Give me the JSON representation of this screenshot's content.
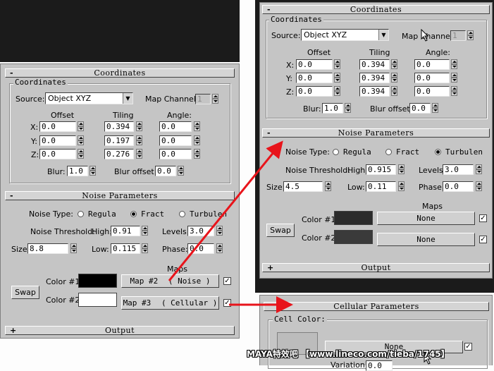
{
  "labels": {
    "coordinates": "Coordinates",
    "coordinates_group": "Coordinates",
    "source": "Source:",
    "map_channel": "Map Channel:",
    "offset": "Offset",
    "tiling": "Tiling",
    "angle": "Angle:",
    "x": "X:",
    "y": "Y:",
    "z": "Z:",
    "blur": "Blur:",
    "blur_offset": "Blur offset:",
    "noise_parameters": "Noise Parameters",
    "noise_type": "Noise Type:",
    "regular": "Regula",
    "fractal": "Fract",
    "turbulence": "Turbulen",
    "noise_threshold": "Noise Threshold:",
    "high": "High:",
    "levels": "Levels:",
    "size": "Size:",
    "low": "Low:",
    "phase": "Phase:",
    "maps": "Maps",
    "color1": "Color #1",
    "color2": "Color #2",
    "swap": "Swap",
    "output": "Output",
    "cellular_parameters": "Cellular Parameters",
    "cell_color": "Cell Color:",
    "variation": "Variation:",
    "none": "None",
    "minus": "-",
    "plus": "+"
  },
  "left": {
    "source": "Object XYZ",
    "map_channel": "1",
    "offset": [
      "0.0",
      "0.0",
      "0.0"
    ],
    "tiling": [
      "0.394",
      "0.197",
      "0.276"
    ],
    "angle": [
      "0.0",
      "0.0",
      "0.0"
    ],
    "blur": "1.0",
    "blur_offset": "0.0",
    "noise_type": "Fractal",
    "high": "0.91",
    "levels": "3.0",
    "size": "8.8",
    "low": "0.115",
    "phase": "0.0",
    "map1": "Map #2",
    "map1_type": "( Noise )",
    "map2": "Map #3",
    "map2_type": "( Cellular )",
    "color1": "#000000",
    "color2": "#ffffff"
  },
  "right": {
    "source": "Object XYZ",
    "map_channel": "1",
    "offset": [
      "0.0",
      "0.0",
      "0.0"
    ],
    "tiling": [
      "0.394",
      "0.394",
      "0.394"
    ],
    "angle": [
      "0.0",
      "0.0",
      "0.0"
    ],
    "blur": "1.0",
    "blur_offset": "0.0",
    "noise_type": "Turbulence",
    "high": "0.915",
    "levels": "3.0",
    "size": "4.5",
    "low": "0.11",
    "phase": "0.0",
    "map1": "None",
    "map2": "None",
    "color1": "#2b2b2b",
    "color2": "#3a3a3a"
  },
  "cellular": {
    "cell_color": "#bcbcbc",
    "map": "None",
    "variation": "0.0"
  },
  "watermark_bottom": "MAYA特效吧 【www.lineco.com/tieba/1745】",
  "colors": {
    "arrow": "#e8141b",
    "panel": "#c5c5c5",
    "dark_background": "#1b1b1b"
  }
}
